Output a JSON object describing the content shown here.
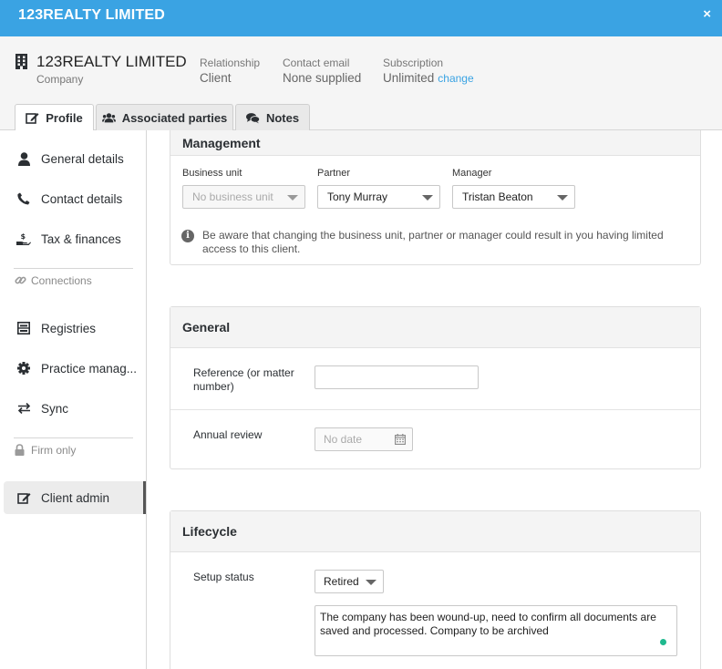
{
  "window": {
    "title": "123REALTY LIMITED",
    "close_label": "×"
  },
  "header": {
    "company_name": "123REALTY LIMITED",
    "company_type": "Company",
    "relationship": {
      "label": "Relationship",
      "value": "Client"
    },
    "contact_email": {
      "label": "Contact email",
      "value": "None supplied"
    },
    "subscription": {
      "label": "Subscription",
      "value": "Unlimited",
      "action": "change"
    }
  },
  "tabs": [
    {
      "label": "Profile",
      "icon": "edit-icon",
      "active": true
    },
    {
      "label": "Associated parties",
      "icon": "users-icon"
    },
    {
      "label": "Notes",
      "icon": "comments-icon"
    }
  ],
  "sidebar": {
    "items": [
      {
        "label": "General details",
        "icon": "user-icon"
      },
      {
        "label": "Contact details",
        "icon": "phone-icon"
      },
      {
        "label": "Tax & finances",
        "icon": "hand-coin-icon"
      },
      {
        "label": "Registries",
        "icon": "register-icon"
      },
      {
        "label": "Practice manag...",
        "icon": "gear-icon"
      },
      {
        "label": "Sync",
        "icon": "sync-icon"
      },
      {
        "label": "Client admin",
        "icon": "edit-icon",
        "active": true
      }
    ],
    "sections": [
      {
        "label": "Connections",
        "icon": "link-icon"
      },
      {
        "label": "Firm only",
        "icon": "lock-icon"
      }
    ]
  },
  "management": {
    "title": "Management",
    "business_unit": {
      "label": "Business unit",
      "placeholder": "No business unit"
    },
    "partner": {
      "label": "Partner",
      "value": "Tony Murray"
    },
    "manager": {
      "label": "Manager",
      "value": "Tristan Beaton"
    },
    "notice": "Be aware that changing the business unit, partner or manager could result in you having limited access to this client."
  },
  "general": {
    "title": "General",
    "reference": {
      "label": "Reference (or matter number)",
      "value": ""
    },
    "annual_review": {
      "label": "Annual review",
      "placeholder": "No date"
    }
  },
  "lifecycle": {
    "title": "Lifecycle",
    "setup_status": {
      "label": "Setup status",
      "value": "Retired"
    },
    "note": "The company has been wound-up, need to confirm all documents are saved and processed. Company to be archived"
  },
  "colors": {
    "brand": "#3aa3e3",
    "status_dot": "#1fb98e"
  }
}
